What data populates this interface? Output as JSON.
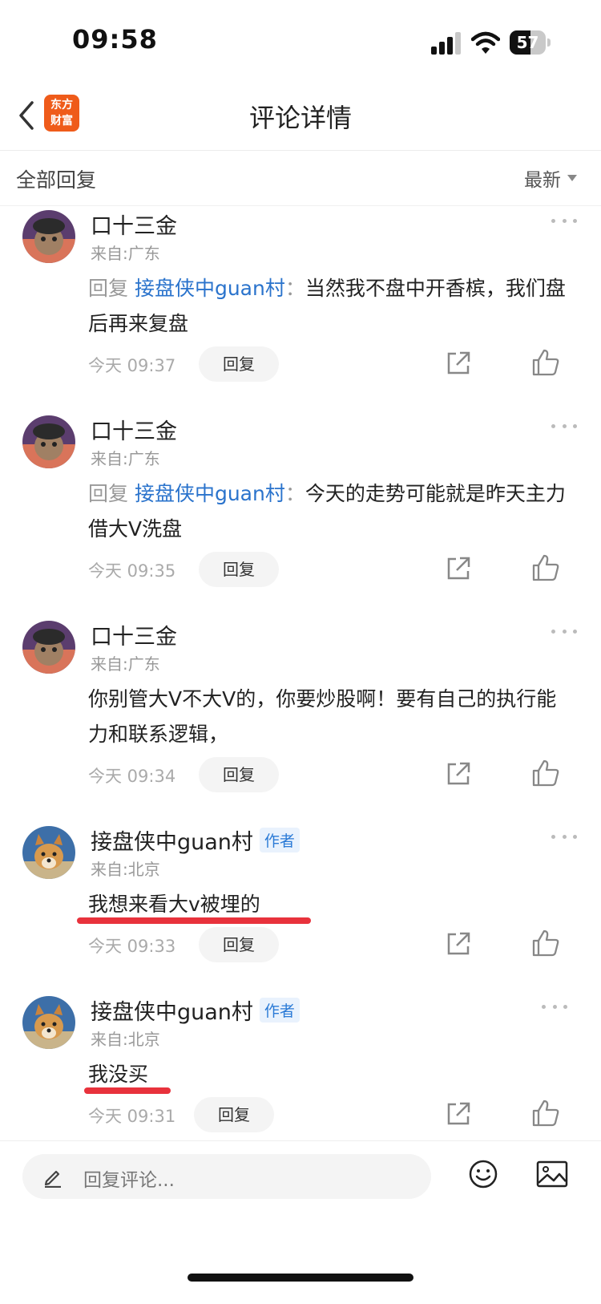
{
  "status_bar": {
    "time": "09:58",
    "battery": "57",
    "battery_level": 0.57
  },
  "nav": {
    "app_logo_line1": "东方",
    "app_logo_line2": "财富",
    "title": "评论详情"
  },
  "filter": {
    "label": "全部回复",
    "sort": "最新"
  },
  "comments": [
    {
      "username": "口十三金",
      "location": "来自:广东",
      "reply_prefix": "回复 ",
      "reply_target": "接盘侠中guan村",
      "reply_sep": "：",
      "text": "当然我不盘中开香槟，我们盘后再来复盘",
      "time": "今天 09:37",
      "reply_label": "回复"
    },
    {
      "username": "口十三金",
      "location": "来自:广东",
      "reply_prefix": "回复 ",
      "reply_target": "接盘侠中guan村",
      "reply_sep": "：",
      "text": "今天的走势可能就是昨天主力借大V洗盘",
      "time": "今天 09:35",
      "reply_label": "回复"
    },
    {
      "username": "口十三金",
      "location": "来自:广东",
      "text": "你别管大V不大V的，你要炒股啊！要有自己的执行能力和联系逻辑，",
      "time": "今天 09:34",
      "reply_label": "回复"
    },
    {
      "username": "接盘侠中guan村",
      "badge": "作者",
      "location": "来自:北京",
      "text": "我想来看大v被埋的",
      "time": "今天 09:33",
      "reply_label": "回复"
    },
    {
      "username": "接盘侠中guan村",
      "badge": "作者",
      "location": "来自:北京",
      "text": "我没买",
      "time": "今天 09:31",
      "reply_label": "回复"
    }
  ],
  "bottom_bar": {
    "placeholder": "回复评论..."
  },
  "colors": {
    "link": "#2a73cc",
    "underline": "#e8323c",
    "logo": "#ef5b1a"
  }
}
